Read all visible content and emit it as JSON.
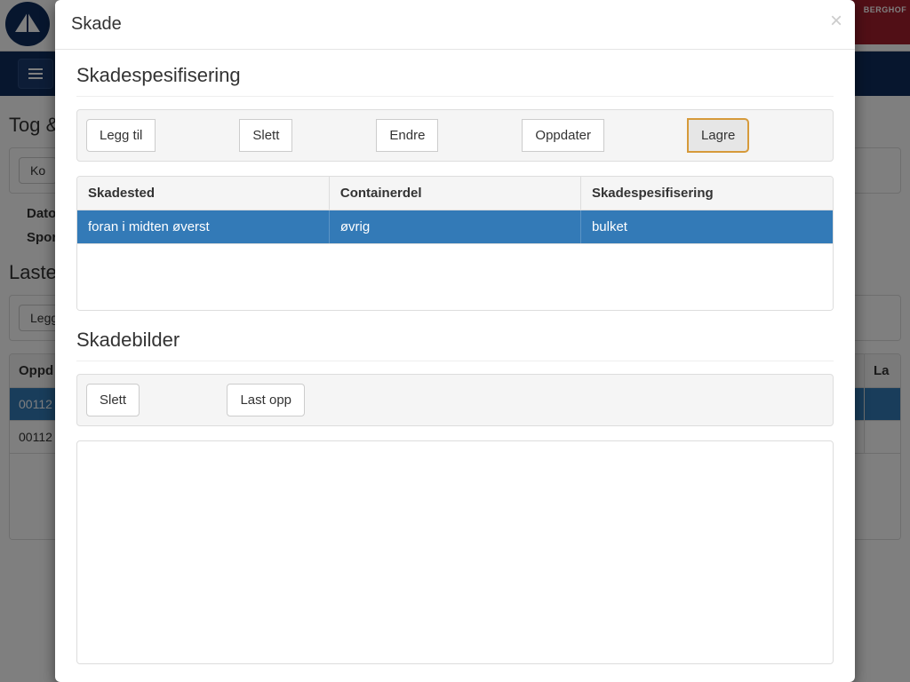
{
  "background": {
    "brand_right": "BERGHOF",
    "heading1_prefix": "Tog &",
    "panel1_btn_prefix": "Ko",
    "label_dato": "Dato",
    "label_spor": "Spor",
    "heading2_prefix": "Lastee",
    "panel2_btn_prefix": "Legg",
    "table_head_left": "Oppd",
    "table_head_right": "La",
    "row1_prefix": "00112",
    "row2_prefix": "00112"
  },
  "modal": {
    "title": "Skade",
    "section1_title": "Skadespesifisering",
    "toolbar": {
      "add": "Legg til",
      "delete": "Slett",
      "edit": "Endre",
      "update": "Oppdater",
      "save": "Lagre"
    },
    "table": {
      "headers": {
        "skadested": "Skadested",
        "containerdel": "Containerdel",
        "skadepesifisering": "Skadespesifisering"
      },
      "rows": [
        {
          "skadested": "foran i midten øverst",
          "containerdel": "øvrig",
          "skadepesifisering": "bulket"
        }
      ]
    },
    "section2_title": "Skadebilder",
    "images_toolbar": {
      "delete": "Slett",
      "upload": "Last opp"
    }
  }
}
